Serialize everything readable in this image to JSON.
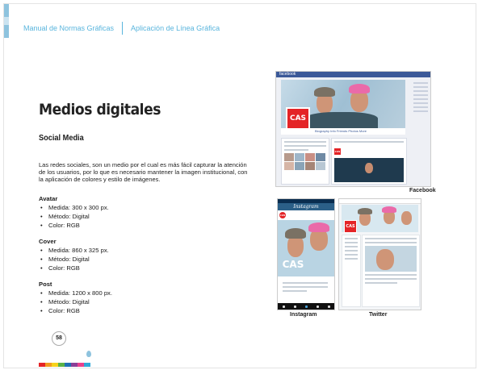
{
  "header": {
    "left": "Manual de Normas Gráficas",
    "right": "Aplicación de Línea Gráfica"
  },
  "title": "Medios digitales",
  "subtitle": "Social Media",
  "paragraph": "Las redes sociales, son un medio por el cual es más fácil capturar la atención de los usuarios, por lo que es necesario mantener la imagen institucional, con la aplicación de colores y estilo de imágenes.",
  "specs": [
    {
      "heading": "Avatar",
      "items": [
        "Medida: 300 x 300 px.",
        "Método: Digital",
        "Color: RGB"
      ]
    },
    {
      "heading": "Cover",
      "items": [
        "Medida: 860 x 325 px.",
        "Método: Digital",
        "Color: RGB"
      ]
    },
    {
      "heading": "Post",
      "items": [
        "Medida: 1200 x 800 px.",
        "Método: Digital",
        "Color: RGB"
      ]
    }
  ],
  "page_number": "58",
  "captions": {
    "facebook": "Facebook",
    "instagram": "Instagram",
    "twitter": "Twitter"
  },
  "mockups": {
    "facebook_brand": "facebook",
    "brand_logo": "CAS",
    "facebook_nav": "Biography   Info   Friends   Photos   More",
    "instagram_brand": "Instagram"
  },
  "colors": {
    "accent": "#59b5dd",
    "brand_red": "#e42427",
    "brand_stripe": [
      "#e42427",
      "#f29a1f",
      "#f7d21b",
      "#5bb246",
      "#1f6fb4",
      "#8a3f96",
      "#e9418c",
      "#2fa8d8"
    ]
  }
}
